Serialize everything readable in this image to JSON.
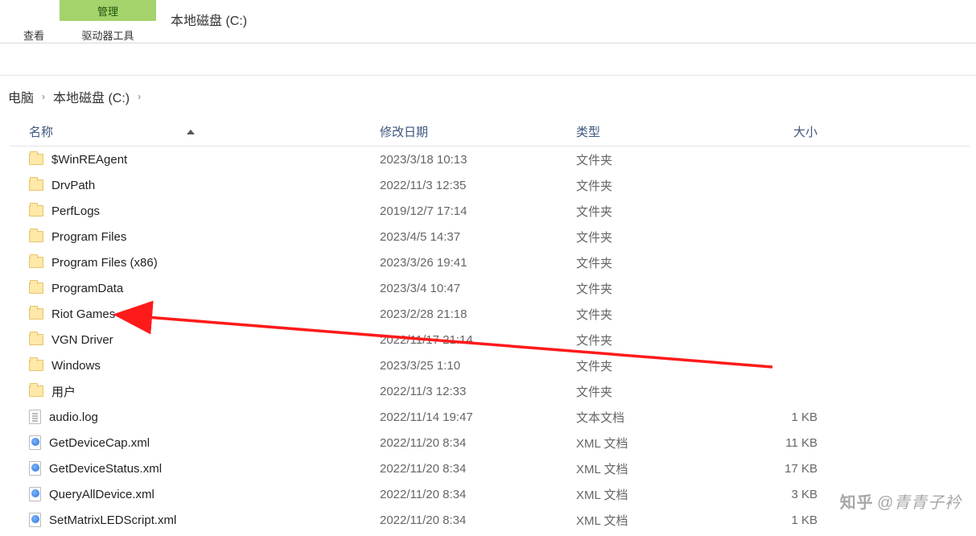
{
  "ribbon": {
    "view_tab": "查看",
    "manage_tab": "管理",
    "drive_tools": "驱动器工具",
    "window_title": "本地磁盘 (C:)"
  },
  "breadcrumb": {
    "items": [
      "电脑",
      "本地磁盘 (C:)"
    ],
    "sep": "›"
  },
  "columns": {
    "name": "名称",
    "date": "修改日期",
    "type": "类型",
    "size": "大小"
  },
  "type_labels": {
    "folder": "文件夹",
    "text": "文本文档",
    "xml": "XML 文档"
  },
  "rows": [
    {
      "icon": "folder",
      "name": "$WinREAgent",
      "date": "2023/3/18 10:13",
      "type": "folder",
      "size": ""
    },
    {
      "icon": "folder",
      "name": "DrvPath",
      "date": "2022/11/3 12:35",
      "type": "folder",
      "size": ""
    },
    {
      "icon": "folder",
      "name": "PerfLogs",
      "date": "2019/12/7 17:14",
      "type": "folder",
      "size": ""
    },
    {
      "icon": "folder",
      "name": "Program Files",
      "date": "2023/4/5 14:37",
      "type": "folder",
      "size": ""
    },
    {
      "icon": "folder",
      "name": "Program Files (x86)",
      "date": "2023/3/26 19:41",
      "type": "folder",
      "size": ""
    },
    {
      "icon": "folder",
      "name": "ProgramData",
      "date": "2023/3/4 10:47",
      "type": "folder",
      "size": ""
    },
    {
      "icon": "folder",
      "name": "Riot Games",
      "date": "2023/2/28 21:18",
      "type": "folder",
      "size": ""
    },
    {
      "icon": "folder",
      "name": "VGN Driver",
      "date": "2022/11/17 21:14",
      "type": "folder",
      "size": ""
    },
    {
      "icon": "folder",
      "name": "Windows",
      "date": "2023/3/25 1:10",
      "type": "folder",
      "size": ""
    },
    {
      "icon": "folder",
      "name": "用户",
      "date": "2022/11/3 12:33",
      "type": "folder",
      "size": ""
    },
    {
      "icon": "log",
      "name": "audio.log",
      "date": "2022/11/14 19:47",
      "type": "text",
      "size": "1 KB"
    },
    {
      "icon": "xml",
      "name": "GetDeviceCap.xml",
      "date": "2022/11/20 8:34",
      "type": "xml",
      "size": "11 KB"
    },
    {
      "icon": "xml",
      "name": "GetDeviceStatus.xml",
      "date": "2022/11/20 8:34",
      "type": "xml",
      "size": "17 KB"
    },
    {
      "icon": "xml",
      "name": "QueryAllDevice.xml",
      "date": "2022/11/20 8:34",
      "type": "xml",
      "size": "3 KB"
    },
    {
      "icon": "xml",
      "name": "SetMatrixLEDScript.xml",
      "date": "2022/11/20 8:34",
      "type": "xml",
      "size": "1 KB"
    }
  ],
  "watermark": {
    "logo": "知乎",
    "text": "@青青子衿"
  }
}
